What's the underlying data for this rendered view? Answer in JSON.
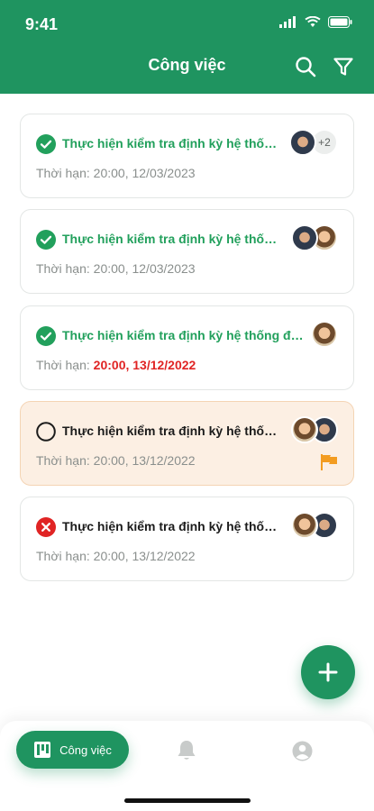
{
  "status_bar": {
    "time": "9:41"
  },
  "header": {
    "title": "Công việc",
    "search_icon": "search-icon",
    "filter_icon": "filter-icon"
  },
  "tasks": [
    {
      "title": "Thực hiện kiểm tra định kỳ hệ thống…",
      "deadline_label": "Thời hạn:",
      "deadline": "20:00, 12/03/2023",
      "status": "done",
      "more_count": "+2",
      "overdue": false
    },
    {
      "title": "Thực hiện kiểm tra định kỳ hệ thốn…",
      "deadline_label": "Thời hạn:",
      "deadline": "20:00, 12/03/2023",
      "status": "done",
      "overdue": false
    },
    {
      "title": "Thực hiện kiểm tra định kỳ hệ thống đè…",
      "deadline_label": "Thời hạn:",
      "deadline": "20:00, 13/12/2022",
      "status": "done",
      "overdue": true
    },
    {
      "title": "Thực hiện kiểm tra định kỳ hệ thốn…",
      "deadline_label": "Thời hạn:",
      "deadline": "20:00, 13/12/2022",
      "status": "pending",
      "flagged": true,
      "overdue": false
    },
    {
      "title": "Thực hiện kiểm tra định kỳ hệ thốn…",
      "deadline_label": "Thời hạn:",
      "deadline": "20:00, 13/12/2022",
      "status": "failed",
      "overdue": false
    }
  ],
  "tabbar": {
    "active_label": "Công việc",
    "tabs": [
      "task-board-icon",
      "bell-icon",
      "profile-icon"
    ]
  },
  "colors": {
    "primary": "#1f9460",
    "done": "#22a05c",
    "overdue": "#e02424",
    "failed": "#e02424",
    "flag": "#f39c21",
    "pending_bg": "#fcefe3"
  }
}
